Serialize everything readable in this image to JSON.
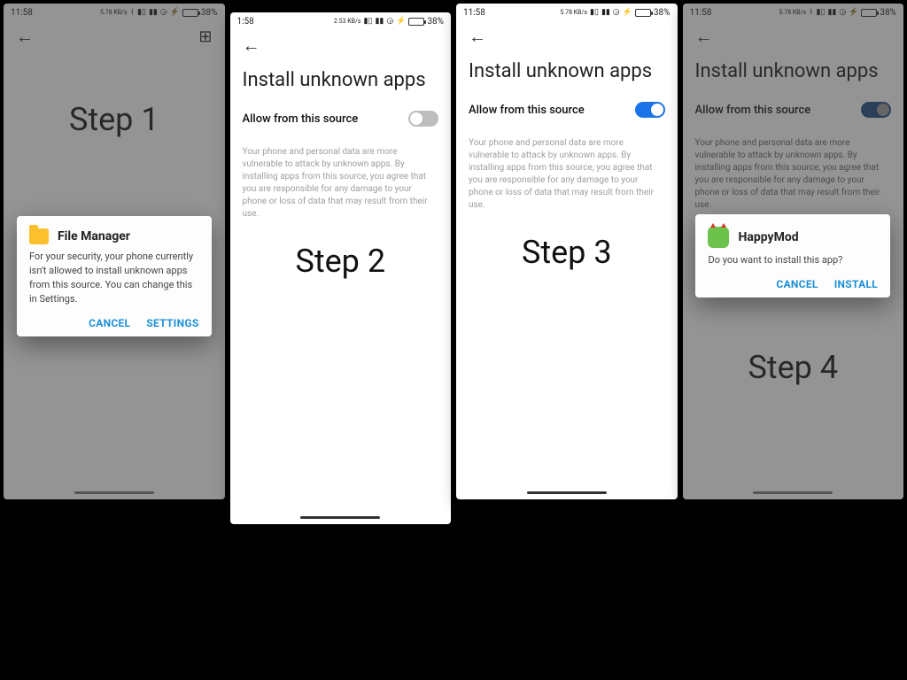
{
  "status": {
    "time_full": "11:58",
    "time_short": "1:58",
    "net_rate": "5.78 KB/s",
    "net_rate2": "2.53 KB/s",
    "battery_pct": "38%",
    "battery_level": 38
  },
  "steps": {
    "s1": "Step 1",
    "s2": "Step 2",
    "s3": "Step 3",
    "s4": "Step 4"
  },
  "settings": {
    "page_title": "Install unknown apps",
    "allow_label": "Allow from this source",
    "warning": "Your phone and personal data are more vulnerable to attack by unknown apps. By installing apps from this source, you agree that you are responsible for any damage to your phone or loss of data that may result from their use."
  },
  "dialog1": {
    "title": "File Manager",
    "body": "For your security, your phone currently isn't allowed to install unknown apps from this source. You can change this in Settings.",
    "cancel": "CANCEL",
    "settings": "SETTINGS"
  },
  "dialog4": {
    "title": "HappyMod",
    "body": "Do you want to install this app?",
    "cancel": "CANCEL",
    "install": "INSTALL"
  }
}
